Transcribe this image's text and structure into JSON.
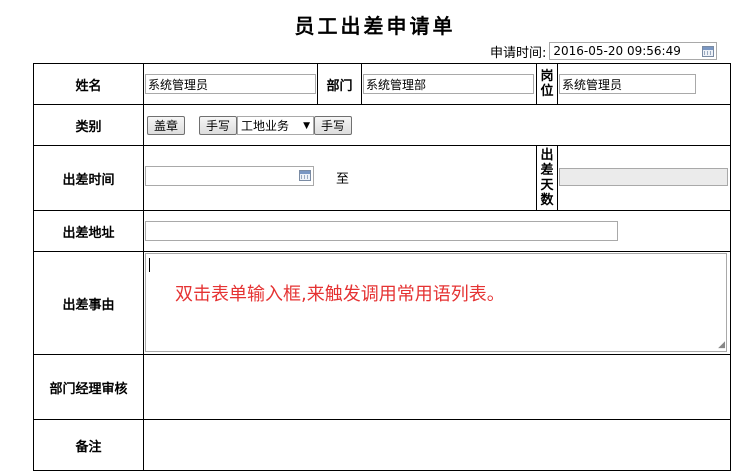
{
  "title": "员工出差申请单",
  "apply_time": {
    "label": "申请时间:",
    "value": "2016-05-20 09:56:49"
  },
  "rows": {
    "name": {
      "label": "姓名",
      "value": "系统管理员"
    },
    "dept": {
      "label": "部门",
      "value": "系统管理部"
    },
    "post": {
      "label": "岗位",
      "value": "系统管理员"
    },
    "category": {
      "label": "类别",
      "btn_stamp": "盖章",
      "btn_hand1": "手写",
      "select_value": "工地业务",
      "btn_hand2": "手写"
    },
    "trip_time": {
      "label": "出差时间",
      "to": "至",
      "days_label": "出差天数"
    },
    "address": {
      "label": "出差地址"
    },
    "reason": {
      "label": "出差事由",
      "hint": "双击表单输入框,来触发调用常用语列表。"
    },
    "manager": {
      "label": "部门经理审核"
    },
    "remark": {
      "label": "备注"
    }
  },
  "colors": {
    "hint": "#e53333",
    "border": "#000000"
  }
}
